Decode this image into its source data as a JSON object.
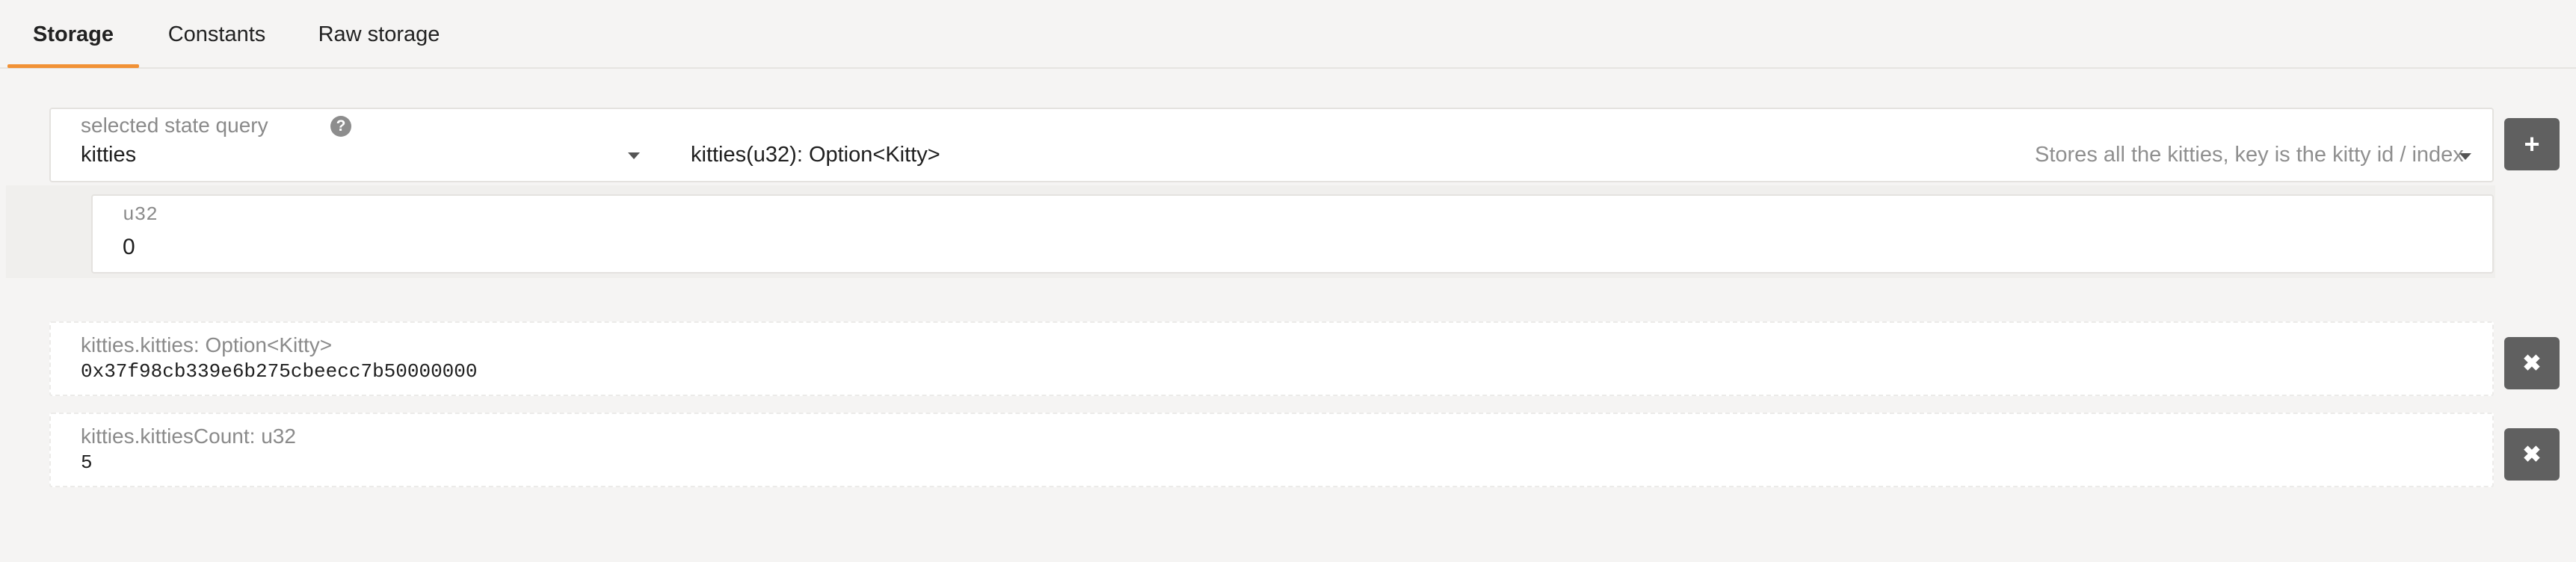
{
  "tabs": [
    {
      "label": "Storage",
      "active": true
    },
    {
      "label": "Constants",
      "active": false
    },
    {
      "label": "Raw storage",
      "active": false
    }
  ],
  "query": {
    "label": "selected state query",
    "help_icon": "question-circle-icon",
    "module": "kitties",
    "signature": "kitties(u32): Option<Kitty>",
    "description": "Stores all the kitties, key is the kitty id / index",
    "add_icon": "plus-icon"
  },
  "param": {
    "label": "u32",
    "value": "0"
  },
  "results": [
    {
      "label": "kitties.kitties: Option<Kitty>",
      "value": "0x37f98cb339e6b275cbeecc7b50000000",
      "remove_icon": "close-icon"
    },
    {
      "label": "kitties.kittiesCount: u32",
      "value": "5",
      "remove_icon": "close-icon"
    }
  ],
  "colors": {
    "accent": "#f19135",
    "button": "#606060",
    "background": "#f5f4f3"
  }
}
